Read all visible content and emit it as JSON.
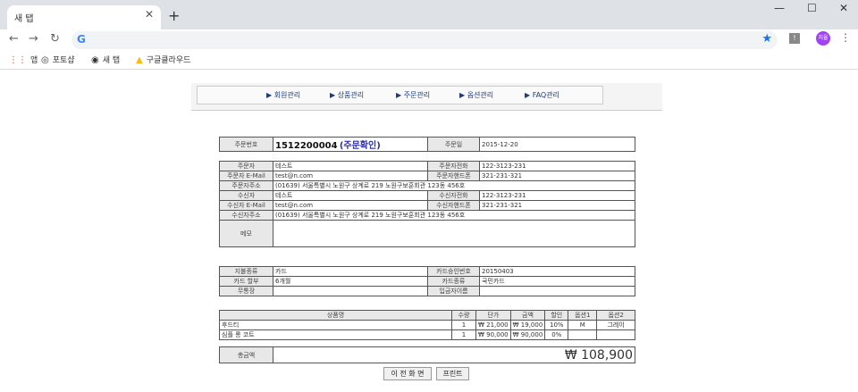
{
  "browser": {
    "tab_title": "새 탭",
    "tab_close": "✕",
    "new_tab": "+",
    "win_min": "—",
    "win_max": "☐",
    "win_close": "✕",
    "back": "←",
    "forward": "→",
    "reload": "↻",
    "g": "G",
    "star": "★",
    "ext_label": "!",
    "avatar": "지율",
    "menu": "⋮",
    "bookmarks": [
      {
        "icon": "⋮⋮",
        "label": "앱"
      },
      {
        "icon": "◎",
        "label": "포토샵"
      },
      {
        "icon": "◉",
        "label": "새 탭"
      },
      {
        "icon": "▲",
        "label": "구글클라우드"
      }
    ]
  },
  "admin_nav": [
    "▶ 회원관리",
    "▶ 상품관리",
    "▶ 주문관리",
    "▶ 옵션관리",
    "▶ FAQ관리"
  ],
  "order": {
    "no_label": "주문번호",
    "no": "1512200004",
    "status": "(주문확인)",
    "date_label": "주문일",
    "date": "2015-12-20"
  },
  "orderer": {
    "name_label": "주문자",
    "name": "테스트",
    "phone_label": "주문자전화",
    "phone": "122-3123-231",
    "email_label": "주문자 E-Mail",
    "email": "test@n.com",
    "mobile_label": "주문자핸드폰",
    "mobile": "321-231-321",
    "addr_label": "주문자주소",
    "addr": "(01639) 서울특별시 노원구 상계로 219 노원구보훈회관 123동 456호"
  },
  "receiver": {
    "name_label": "수신자",
    "name": "테스트",
    "phone_label": "수신자전화",
    "phone": "122-3123-231",
    "email_label": "수신자 E-Mail",
    "email": "test@n.com",
    "mobile_label": "수신자핸드폰",
    "mobile": "321-231-321",
    "addr_label": "수신자주소",
    "addr": "(01639) 서울특별시 노원구 상계로 219 노원구보훈회관 123동 456호",
    "memo_label": "메모",
    "memo": ""
  },
  "payment": {
    "type_label": "지불종류",
    "type": "카드",
    "approval_label": "카드승인번호",
    "approval": "20150403",
    "install_label": "카드 할부",
    "install": "6개월",
    "card_type_label": "카드종류",
    "card_type": "국민카드",
    "bank_label": "무통장",
    "bank": "",
    "depositor_label": "입금자이름",
    "depositor": ""
  },
  "items": {
    "headers": [
      "상품명",
      "수량",
      "단가",
      "금액",
      "할인",
      "옵션1",
      "옵션2"
    ],
    "rows": [
      [
        "후드티",
        "1",
        "₩ 21,000",
        "₩ 19,000",
        "10%",
        "M",
        "그레이"
      ],
      [
        "심플 롱 코트",
        "1",
        "₩ 90,000",
        "₩ 90,000",
        "0%",
        "",
        ""
      ]
    ]
  },
  "total": {
    "label": "총금액",
    "value": "₩ 108,900"
  },
  "buttons": {
    "back": "이 전 화 면",
    "print": "프린트"
  }
}
